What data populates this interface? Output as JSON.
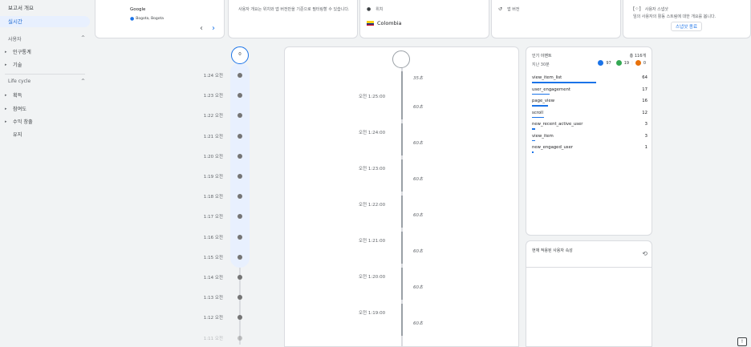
{
  "sidebar": {
    "report_overview": "보고서 개요",
    "realtime": "실시간",
    "user_section": "사용자",
    "user_items": [
      {
        "label": "인구통계"
      },
      {
        "label": "기술"
      }
    ],
    "lifecycle_section": "Life cycle",
    "lifecycle_items": [
      {
        "label": "획득"
      },
      {
        "label": "참여도"
      },
      {
        "label": "수익 창출"
      }
    ],
    "retention": "유지"
  },
  "cards": {
    "source_name": "Google",
    "source_location": "Bogota, Bogota",
    "desc_text": "사용자 개요는 위치와 앱 버전만을 기준으로 필터링할 수 있습니다.",
    "location_label": "위치",
    "location_value": "Colombia",
    "app_version_label": "앱 버전",
    "snapshot_title": "사용자 스냅샷",
    "snapshot_desc": "임의 사용자의 활동 스트림에 대한 개요를 봅니다.",
    "snapshot_button": "스냅샷 종료"
  },
  "timeline": {
    "top_count": "0",
    "times": [
      "1:24 오전",
      "1:23 오전",
      "1:22 오전",
      "1:21 오전",
      "1:20 오전",
      "1:19 오전",
      "1:18 오전",
      "1:17 오전",
      "1:16 오전",
      "1:15 오전",
      "1:14 오전",
      "1:13 오전",
      "1:12 오전",
      "1:11 오전"
    ]
  },
  "stream": {
    "entries": [
      {
        "time": "",
        "duration": "35초"
      },
      {
        "time": "오전 1:25:00",
        "duration": "60초"
      },
      {
        "time": "오전 1:24:00",
        "duration": "60초"
      },
      {
        "time": "오전 1:23:00",
        "duration": "60초"
      },
      {
        "time": "오전 1:22:00",
        "duration": "60초"
      },
      {
        "time": "오전 1:21:00",
        "duration": "60초"
      },
      {
        "time": "오전 1:20:00",
        "duration": "60초"
      },
      {
        "time": "오전 1:19:00",
        "duration": "60초"
      }
    ]
  },
  "events": {
    "title": "인기 이벤트",
    "total": "총 116개",
    "period": "지난 30분",
    "count_blue": "97",
    "count_green": "19",
    "count_orange": "0",
    "rows": [
      {
        "name": "view_item_list",
        "count": "64",
        "ratio": 1.0
      },
      {
        "name": "user_engagement",
        "count": "17",
        "ratio": 0.27
      },
      {
        "name": "page_view",
        "count": "16",
        "ratio": 0.25
      },
      {
        "name": "scroll",
        "count": "12",
        "ratio": 0.19
      },
      {
        "name": "new_recent_active_user",
        "count": "3",
        "ratio": 0.05
      },
      {
        "name": "view_item",
        "count": "3",
        "ratio": 0.05
      },
      {
        "name": "new_engaged_user",
        "count": "1",
        "ratio": 0.02
      }
    ],
    "colors": {
      "blue": "#1a73e8",
      "green": "#34a853",
      "orange": "#e8710a"
    }
  },
  "user_props": {
    "title": "현재 적용된 사용자 속성"
  },
  "feedback_icon": "feedback-icon"
}
